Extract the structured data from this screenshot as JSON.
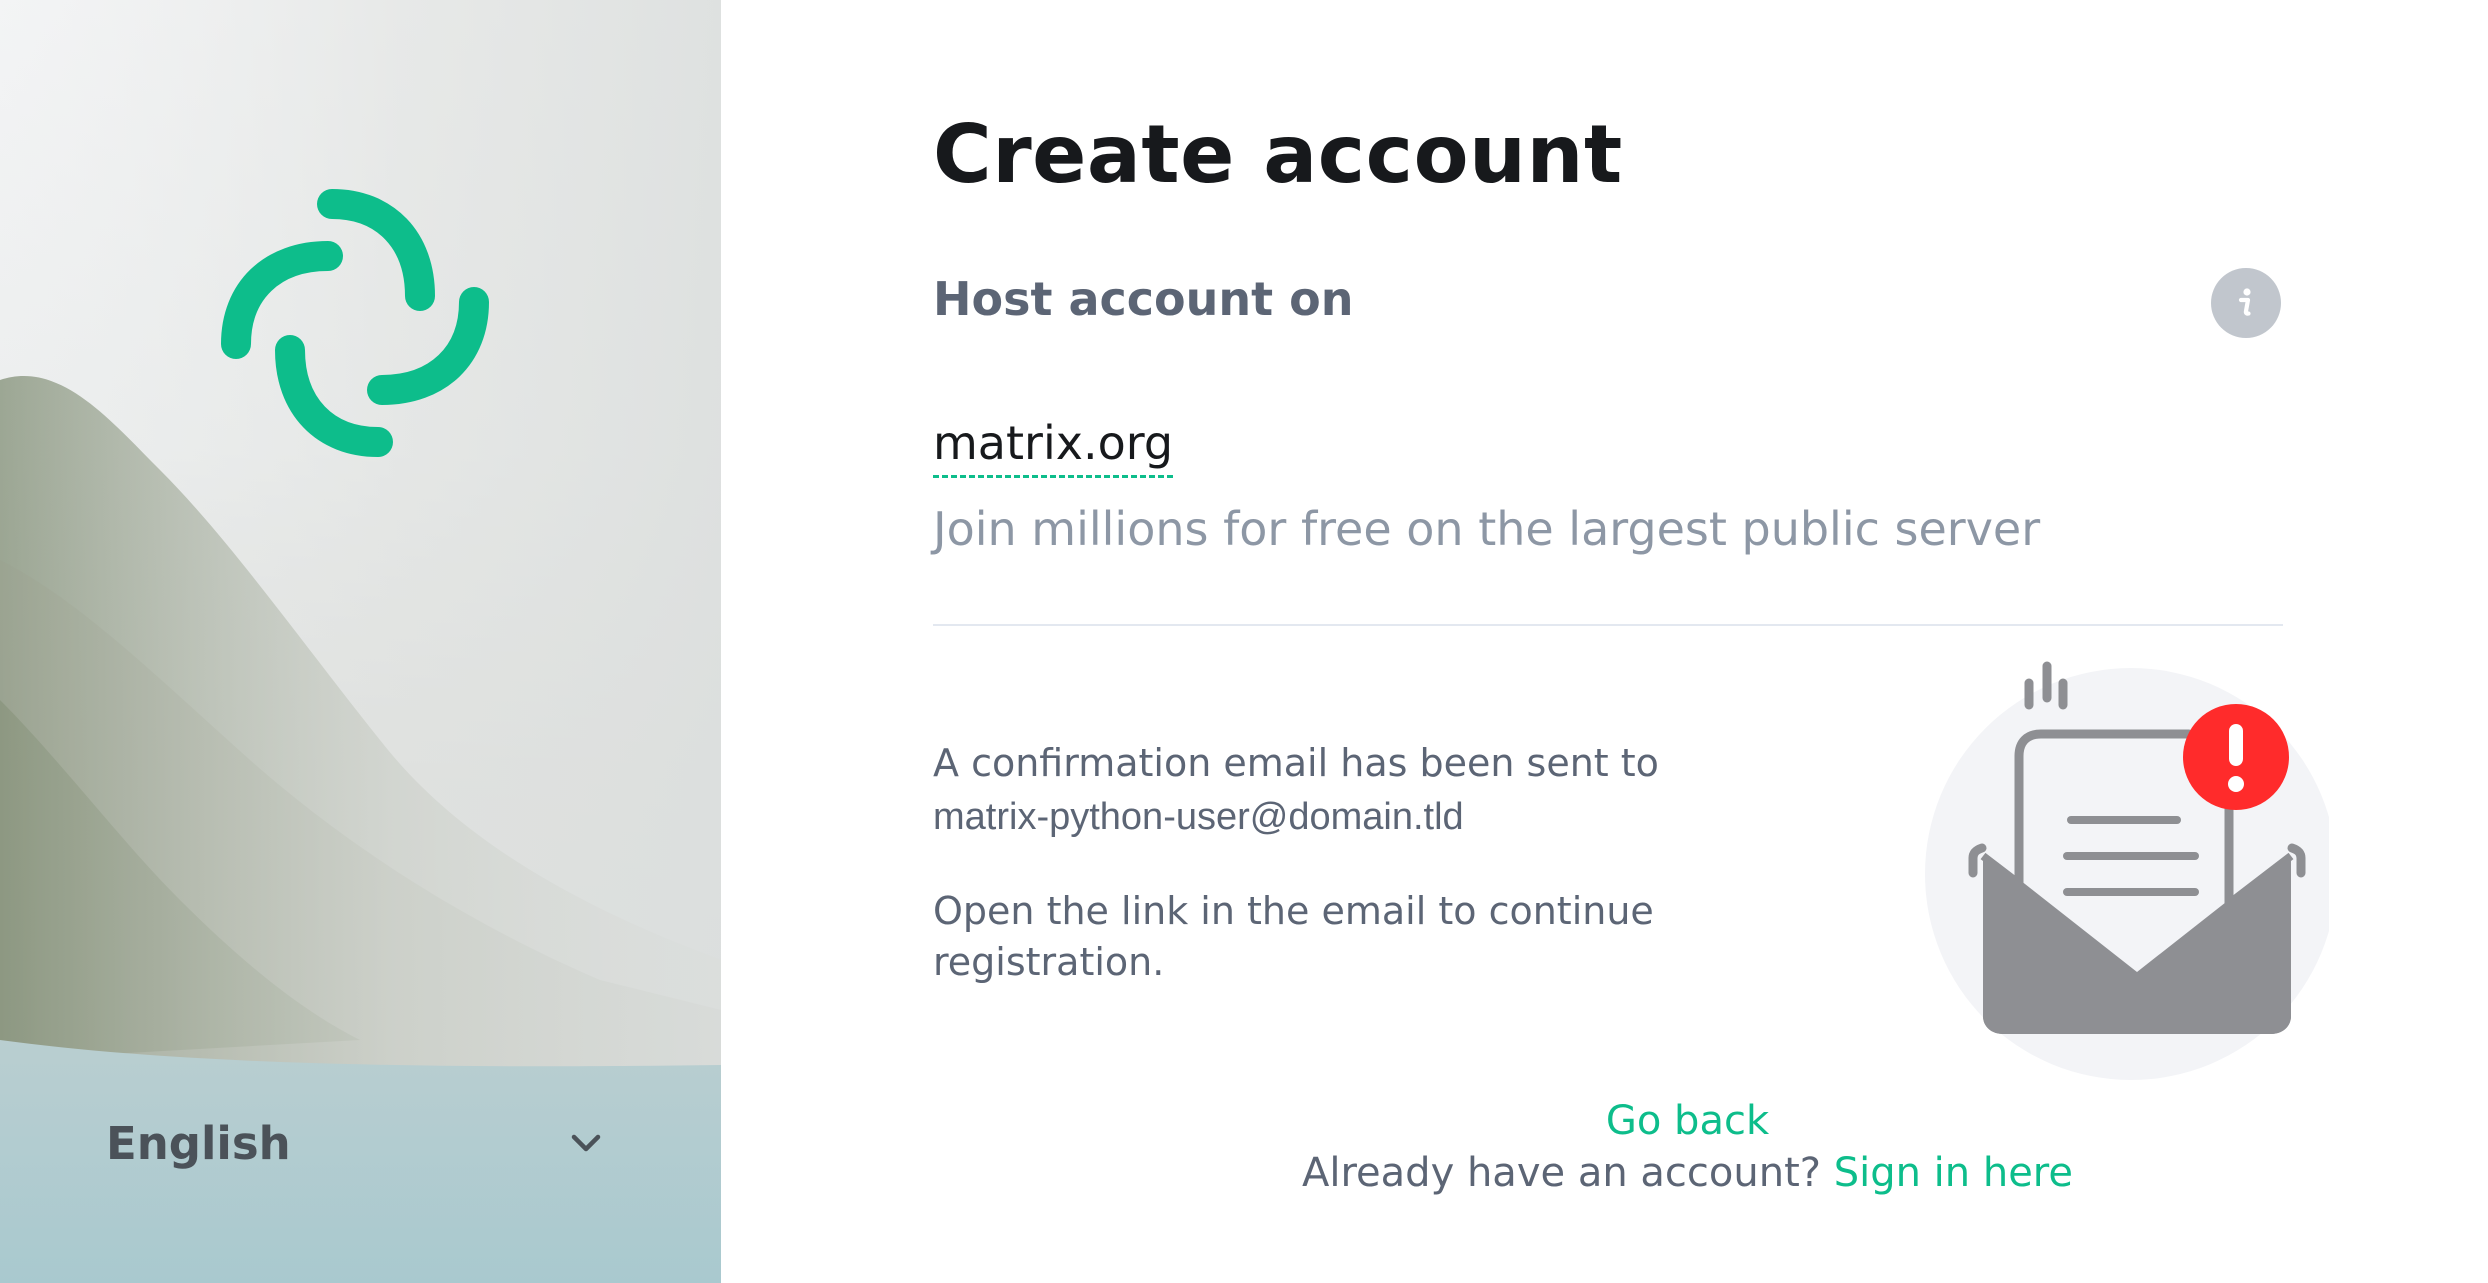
{
  "sidebar": {
    "language": {
      "selected": "English",
      "icon": "chevron-down-icon"
    },
    "logo": {
      "icon": "element-logo-icon",
      "color": "#0dbd8b"
    }
  },
  "main": {
    "title": "Create account",
    "host": {
      "label": "Host account on",
      "info_icon": "info-icon",
      "server_name": "matrix.org",
      "server_description": "Join millions for free on the largest public server"
    },
    "confirmation": {
      "message": "A confirmation email has been sent to",
      "email": "matrix-python-user@domain.tld",
      "instruction": "Open the link in the email to continue registration.",
      "illustration_icon": "open-envelope-alert-icon"
    },
    "footer": {
      "go_back": "Go back",
      "already_have_account": "Already have an account? ",
      "sign_in": "Sign in here"
    }
  },
  "colors": {
    "accent": "#0dbd8b",
    "alert": "#ff2b2b",
    "text_primary": "#17191c",
    "text_secondary": "#5c6575",
    "text_muted": "#8d97a5"
  }
}
